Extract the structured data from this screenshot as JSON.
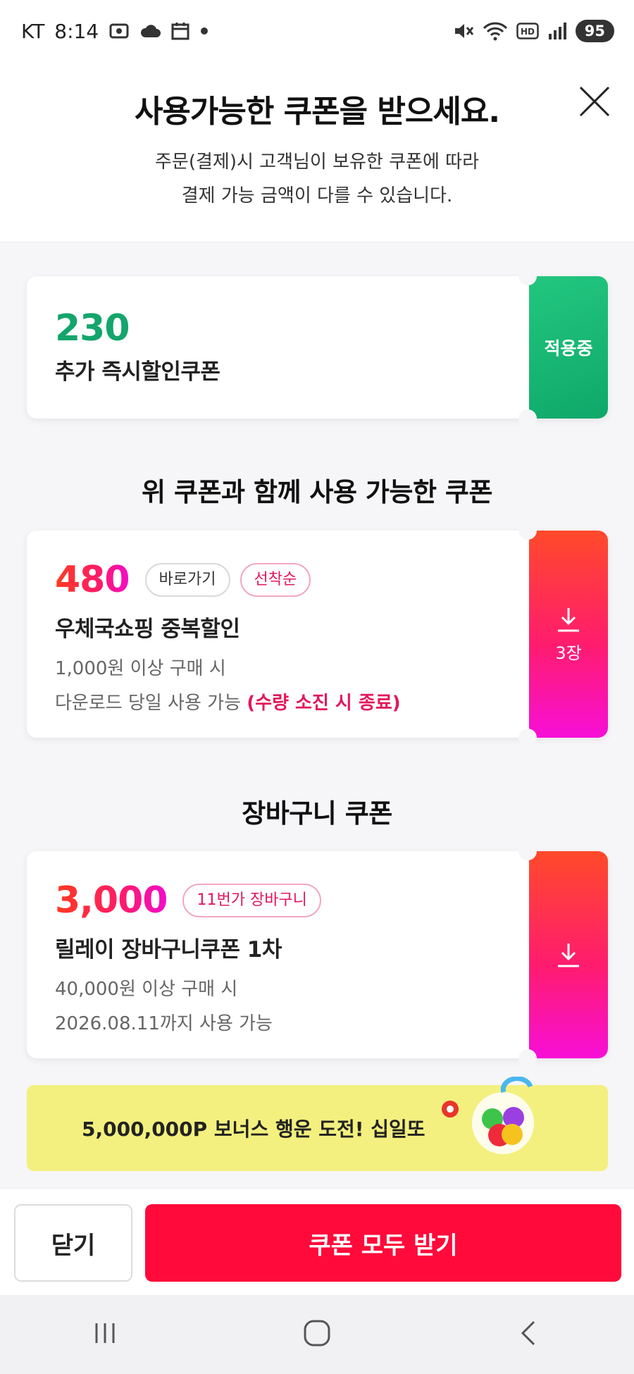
{
  "status_bar": {
    "carrier": "KT",
    "time": "8:14",
    "battery": "95",
    "icons": [
      "screenshot-icon",
      "cloud-icon",
      "calendar-icon",
      "dot-icon",
      "mute-icon",
      "wifi-icon",
      "hd-icon",
      "signal-icon",
      "battery-icon"
    ]
  },
  "header": {
    "title": "사용가능한 쿠폰을 받으세요.",
    "subtitle_line1": "주문(결제)시 고객님이 보유한 쿠폰에 따라",
    "subtitle_line2": "결제 가능 금액이 다를 수 있습니다."
  },
  "coupons": [
    {
      "amount": "230",
      "title": "추가 즉시할인쿠폰",
      "stub_label": "적용중",
      "stub_color": "#14a56c"
    },
    {
      "amount": "480",
      "tags": [
        "바로가기",
        "선착순"
      ],
      "title": "우체국쇼핑 중복할인",
      "condition": "1,000원 이상 구매 시",
      "validity": "다운로드 당일 사용 가능",
      "validity_note": "(수량 소진 시 종료)",
      "stub_count": "3장",
      "stub_icon": "download-icon"
    },
    {
      "amount": "3,000",
      "tags": [
        "11번가 장바구니"
      ],
      "title": "릴레이 장바구니쿠폰 1차",
      "condition": "40,000원 이상 구매 시",
      "validity": "2026.08.11까지 사용 가능",
      "stub_icon": "download-icon"
    }
  ],
  "sections": {
    "combinable": "위 쿠폰과 함께 사용 가능한 쿠폰",
    "cart": "장바구니 쿠폰"
  },
  "banner": {
    "text": "5,000,000P 보너스 행운 도전! 십일또"
  },
  "footer": {
    "close_label": "닫기",
    "get_all_label": "쿠폰 모두 받기"
  },
  "colors": {
    "accent_red": "#ff0a3a",
    "accent_green": "#14a56c",
    "banner_yellow": "#f3f07f"
  }
}
